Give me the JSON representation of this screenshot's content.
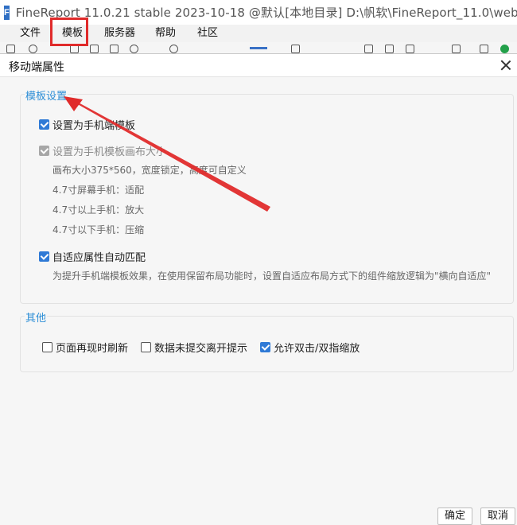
{
  "app": {
    "logo_text": "F",
    "title": "FineReport 11.0.21 stable 2023-10-18 @默认[本地目录]    D:\\帆软\\FineReport_11.0\\web"
  },
  "menubar": {
    "items": [
      {
        "label": "文件"
      },
      {
        "label": "模板"
      },
      {
        "label": "服务器"
      },
      {
        "label": "帮助"
      },
      {
        "label": "社区"
      }
    ]
  },
  "dialog": {
    "title": "移动端属性",
    "template_settings": {
      "legend": "模板设置",
      "set_as_mobile_template": {
        "label": "设置为手机端模板",
        "checked": true
      },
      "set_canvas_size": {
        "label": "设置为手机模板画布大小",
        "checked": true,
        "disabled": true
      },
      "canvas_size_note": "画布大小375*560，宽度锁定，高度可自定义",
      "screen_rules": [
        "4.7寸屏幕手机：适配",
        "4.7寸以上手机：放大",
        "4.7寸以下手机：压缩"
      ],
      "adaptive_match": {
        "label": "自适应属性自动匹配",
        "checked": true
      },
      "adaptive_note": "为提升手机端模板效果，在使用保留布局功能时，设置自适应布局方式下的组件缩放逻辑为\"横向自适应\""
    },
    "other": {
      "legend": "其他",
      "options": [
        {
          "label": "页面再现时刷新",
          "checked": false
        },
        {
          "label": "数据未提交离开提示",
          "checked": false
        },
        {
          "label": "允许双击/双指缩放",
          "checked": true
        }
      ]
    },
    "buttons": {
      "ok": "确定",
      "cancel": "取消"
    }
  },
  "colors": {
    "accent": "#2f7ad6",
    "legend_text": "#2d8ed6",
    "annotation_red": "#e02b2b"
  }
}
